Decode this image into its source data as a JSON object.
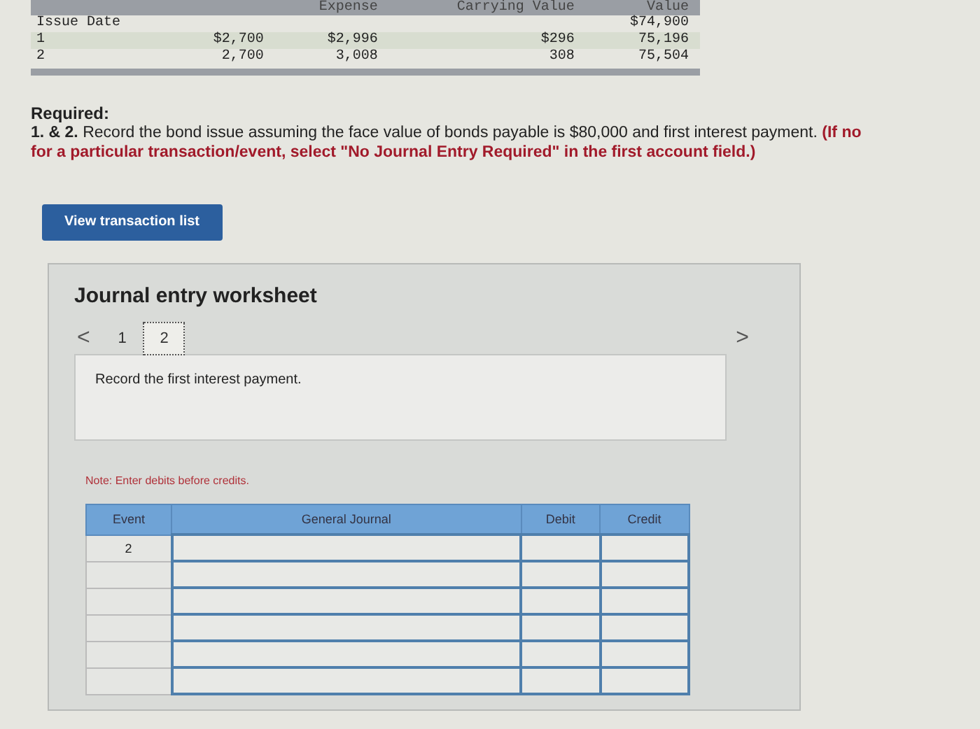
{
  "amortization_table": {
    "columns": [
      "",
      "",
      "Expense",
      "Carrying Value",
      "Value"
    ],
    "rows": [
      [
        "Issue Date",
        "",
        "",
        "",
        "$74,900"
      ],
      [
        "1",
        "$2,700",
        "$2,996",
        "$296",
        "75,196"
      ],
      [
        "2",
        "2,700",
        "3,008",
        "308",
        "75,504"
      ]
    ]
  },
  "required": {
    "heading": "Required:",
    "number": "1. & 2.",
    "text": "Record the bond issue assuming the face value of bonds payable is $80,000 and first interest payment.",
    "note": "(If no",
    "note_continued": "for a particular transaction/event, select \"No Journal Entry Required\" in the first account field.)"
  },
  "view_button": "View transaction list",
  "worksheet": {
    "title": "Journal entry worksheet",
    "prev": "<",
    "next": ">",
    "pages": [
      {
        "label": "1",
        "selected": false
      },
      {
        "label": "2",
        "selected": true
      }
    ],
    "instruction": "Record the first interest payment.",
    "note": "Note: Enter debits before credits.",
    "columns": [
      "Event",
      "General Journal",
      "Debit",
      "Credit"
    ],
    "rows": [
      {
        "event": "2"
      },
      {
        "event": ""
      },
      {
        "event": ""
      },
      {
        "event": ""
      },
      {
        "event": ""
      },
      {
        "event": ""
      }
    ]
  }
}
